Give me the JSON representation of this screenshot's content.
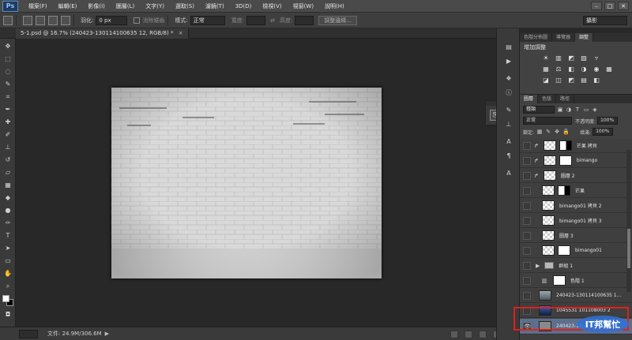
{
  "app": {
    "logo": "Ps"
  },
  "menu": [
    "檔案(F)",
    "編輯(E)",
    "影像(I)",
    "圖層(L)",
    "文字(Y)",
    "選取(S)",
    "濾鏡(T)",
    "3D(D)",
    "檢視(V)",
    "視窗(W)",
    "說明(H)"
  ],
  "window_controls": {
    "minimize": "–",
    "maximize": "□",
    "close": "✕"
  },
  "options": {
    "feather_label": "羽化:",
    "feather_value": "0 px",
    "antialias_label": "消除鋸齒",
    "style_label": "樣式:",
    "style_value": "正常",
    "width_label": "寬度:",
    "height_label": "高度:",
    "refine_button": "調整邊緣...",
    "workspace": "攝影"
  },
  "document_tab": {
    "title": "5-1.psd @ 16.7% (240423-130114100635 12, RGB/8) *",
    "close": "×"
  },
  "status": {
    "doc_size": "文件: 24.9M/306.6M",
    "arrow": "▶"
  },
  "adjustments": {
    "tabs": [
      "色階分佈圖",
      "導覽器",
      "調整"
    ],
    "active_tab": 2,
    "title": "增加調整",
    "row1": [
      "☀",
      "▥",
      "◩",
      "▨",
      "▿"
    ],
    "row2": [
      "▦",
      "⚖",
      "◧",
      "◑",
      "◉",
      "▦"
    ],
    "row3": [
      "◪",
      "◫",
      "◩",
      "▤",
      "◧"
    ]
  },
  "layers": {
    "tabs": [
      "圖層",
      "色版",
      "路徑"
    ],
    "active_tab": 0,
    "filter_value": "種類",
    "blend_mode": "正常",
    "opacity_label": "不透明度:",
    "opacity_value": "100%",
    "lock_label": "鎖定:",
    "fill_label": "填滿:",
    "fill_value": "100%",
    "items": [
      {
        "name": "芒果 拷貝",
        "type": "masked",
        "clip": "↱",
        "visible": false
      },
      {
        "name": "bimango",
        "type": "masked-photo",
        "clip": "↱",
        "visible": false
      },
      {
        "name": "圖層 2",
        "type": "plain",
        "clip": "↱",
        "visible": false
      },
      {
        "name": "芒果",
        "type": "masked-dark",
        "visible": false
      },
      {
        "name": "bimango01 拷貝 2",
        "type": "plain",
        "visible": false
      },
      {
        "name": "bimango01 拷貝 3",
        "type": "plain",
        "visible": false
      },
      {
        "name": "圖層 3",
        "type": "plain",
        "visible": false
      },
      {
        "name": "bimango01",
        "type": "masked",
        "visible": false
      },
      {
        "name": "群組 1",
        "type": "group",
        "visible": false
      },
      {
        "name": "色階 1",
        "type": "adjustment",
        "visible": false
      },
      {
        "name": "240423-130114100635 1...",
        "type": "photo",
        "visible": false
      },
      {
        "name": "1045531 101108003 2",
        "type": "photo2",
        "visible": false
      },
      {
        "name": "240423-13...",
        "type": "solid",
        "visible": true,
        "selected": true
      }
    ]
  },
  "watermark_text": "IT邦幫忙"
}
